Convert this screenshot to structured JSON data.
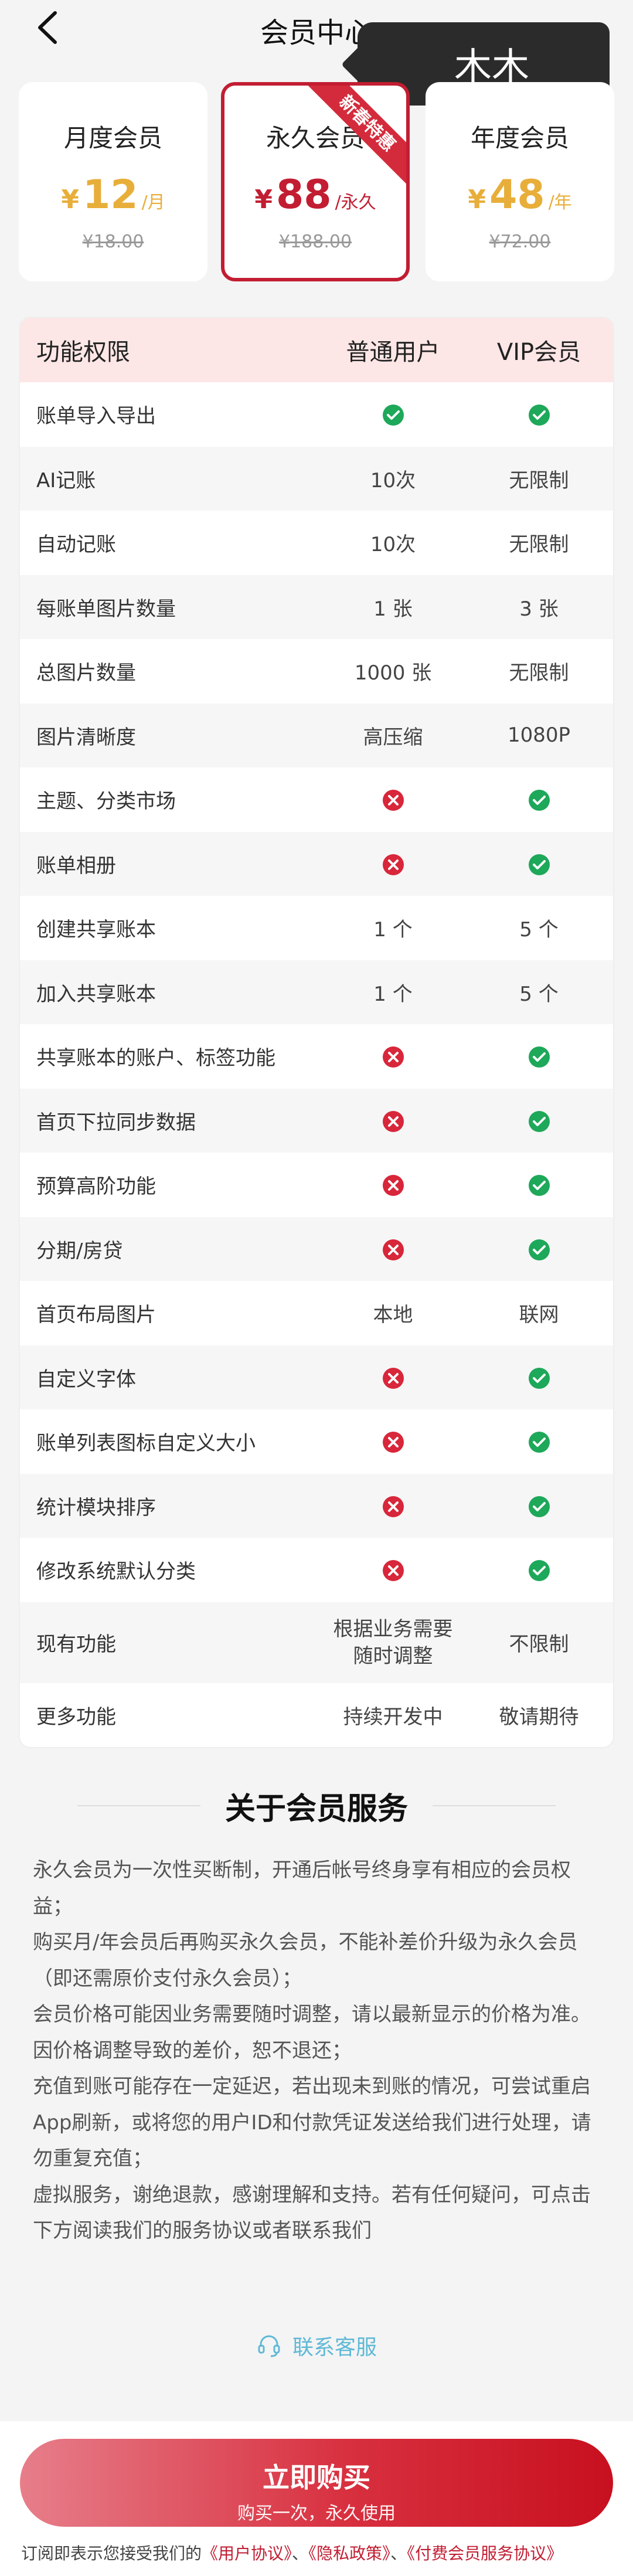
{
  "header": {
    "title": "会员中心",
    "user_tag": "木木"
  },
  "plans": [
    {
      "name": "月度会员",
      "currency": "¥",
      "price": "12",
      "unit": "/月",
      "original": "¥18.00",
      "selected": false
    },
    {
      "name": "永久会员",
      "currency": "¥",
      "price": "88",
      "unit": "/永久",
      "original": "¥188.00",
      "selected": true,
      "ribbon": "新春特惠"
    },
    {
      "name": "年度会员",
      "currency": "¥",
      "price": "48",
      "unit": "/年",
      "original": "¥72.00",
      "selected": false
    }
  ],
  "table": {
    "headers": [
      "功能权限",
      "普通用户",
      "VIP会员"
    ],
    "rows": [
      {
        "feature": "账单导入导出",
        "normal": "✓",
        "vip": "✓"
      },
      {
        "feature": "AI记账",
        "normal": "10次",
        "vip": "无限制"
      },
      {
        "feature": "自动记账",
        "normal": "10次",
        "vip": "无限制"
      },
      {
        "feature": "每账单图片数量",
        "normal": "1 张",
        "vip": "3 张"
      },
      {
        "feature": "总图片数量",
        "normal": "1000 张",
        "vip": "无限制"
      },
      {
        "feature": "图片清晰度",
        "normal": "高压缩",
        "vip": "1080P"
      },
      {
        "feature": "主题、分类市场",
        "normal": "✗",
        "vip": "✓"
      },
      {
        "feature": "账单相册",
        "normal": "✗",
        "vip": "✓"
      },
      {
        "feature": "创建共享账本",
        "normal": "1 个",
        "vip": "5 个"
      },
      {
        "feature": "加入共享账本",
        "normal": "1 个",
        "vip": "5 个"
      },
      {
        "feature": "共享账本的账户、标签功能",
        "normal": "✗",
        "vip": "✓"
      },
      {
        "feature": "首页下拉同步数据",
        "normal": "✗",
        "vip": "✓"
      },
      {
        "feature": "预算高阶功能",
        "normal": "✗",
        "vip": "✓"
      },
      {
        "feature": "分期/房贷",
        "normal": "✗",
        "vip": "✓"
      },
      {
        "feature": "首页布局图片",
        "normal": "本地",
        "vip": "联网"
      },
      {
        "feature": "自定义字体",
        "normal": "✗",
        "vip": "✓"
      },
      {
        "feature": "账单列表图标自定义大小",
        "normal": "✗",
        "vip": "✓"
      },
      {
        "feature": "统计模块排序",
        "normal": "✗",
        "vip": "✓"
      },
      {
        "feature": "修改系统默认分类",
        "normal": "✗",
        "vip": "✓"
      },
      {
        "feature": "现有功能",
        "normal": "根据业务需要\n随时调整",
        "vip": "不限制"
      },
      {
        "feature": "更多功能",
        "normal": "持续开发中",
        "vip": "敬请期待"
      }
    ]
  },
  "about": {
    "title": "关于会员服务",
    "paragraphs": [
      "永久会员为一次性买断制，开通后帐号终身享有相应的会员权益；",
      "购买月/年会员后再购买永久会员，不能补差价升级为永久会员（即还需原价支付永久会员）；",
      "会员价格可能因业务需要随时调整，请以最新显示的价格为准。因价格调整导致的差价，恕不退还；",
      "充值到账可能存在一定延迟，若出现未到账的情况，可尝试重启App刷新，或将您的用户ID和付款凭证发送给我们进行处理，请勿重复充值；",
      "虚拟服务，谢绝退款，感谢理解和支持。若有任何疑问，可点击下方阅读我们的服务协议或者联系我们"
    ],
    "contact_label": "联系客服"
  },
  "bottom": {
    "buy_label": "立即购买",
    "buy_sub": "购买一次，永久使用",
    "terms_prefix": "订阅即表示您接受我们的",
    "terms_links": [
      "《用户协议》",
      "《隐私政策》",
      "《付费会员服务协议》"
    ],
    "terms_sep": "、"
  },
  "colors": {
    "accent": "#c21d32",
    "gold": "#e8ae3a",
    "ok_green": "#1ea85a",
    "no_red": "#d8263a",
    "table_header_bg": "#fde6e6",
    "contact_blue": "#5fb9d6"
  },
  "icons": {
    "back": "chevron-left-icon",
    "ok": "check-circle-icon",
    "no": "cross-circle-icon",
    "contact": "headset-icon"
  }
}
